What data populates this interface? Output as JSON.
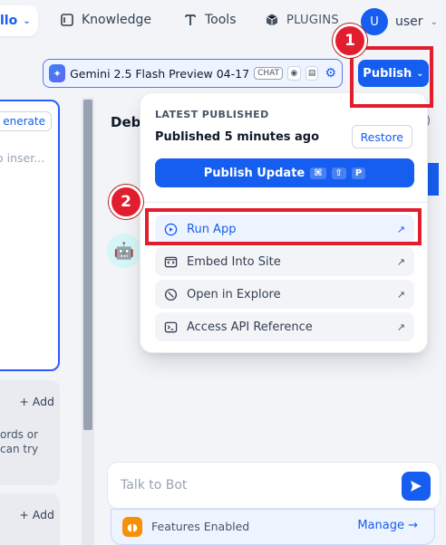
{
  "topbar": {
    "app_name": "llo",
    "nav": [
      {
        "label": "Knowledge"
      },
      {
        "label": "Tools"
      },
      {
        "label": "PLUGINS"
      }
    ],
    "user": {
      "avatar_letter": "U",
      "name": "user"
    }
  },
  "model": {
    "name": "Gemini 2.5 Flash Preview 04-17",
    "tag": "CHAT"
  },
  "publish_button": {
    "label": "Publish"
  },
  "left_panel": {
    "generate_label": "enerate",
    "placeholder": "o inser...",
    "add_label_1": "+ Add",
    "text_line_1": "ords or",
    "text_line_2": "can try",
    "add_label_2": "+ Add"
  },
  "debug": {
    "title": "Deb",
    "paren": ")",
    "chat_placeholder": "Talk to Bot",
    "features_text": "Features Enabled",
    "manage_label": "Manage →"
  },
  "popup": {
    "section_label": "LATEST PUBLISHED",
    "published_text": "Published 5 minutes ago",
    "restore_label": "Restore",
    "publish_update_label": "Publish Update",
    "shortcut_keys": [
      "⌘",
      "⇧",
      "P"
    ],
    "items": [
      {
        "label": "Run App",
        "icon": "play-circle-icon"
      },
      {
        "label": "Embed Into Site",
        "icon": "embed-icon"
      },
      {
        "label": "Open in Explore",
        "icon": "explore-icon"
      },
      {
        "label": "Access API Reference",
        "icon": "terminal-icon"
      }
    ]
  },
  "annotations": {
    "badge_1": "1",
    "badge_2": "2"
  },
  "colors": {
    "primary": "#155eef",
    "annotation_red": "#e11d2e"
  }
}
